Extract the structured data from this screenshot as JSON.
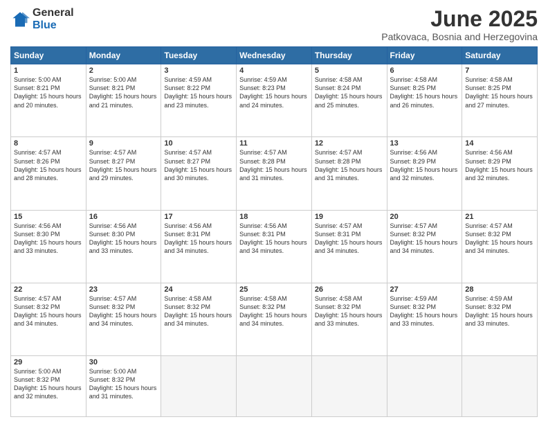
{
  "logo": {
    "general": "General",
    "blue": "Blue"
  },
  "title": "June 2025",
  "subtitle": "Patkovaca, Bosnia and Herzegovina",
  "headers": [
    "Sunday",
    "Monday",
    "Tuesday",
    "Wednesday",
    "Thursday",
    "Friday",
    "Saturday"
  ],
  "weeks": [
    [
      {
        "day": "1",
        "sunrise": "5:00 AM",
        "sunset": "8:21 PM",
        "daylight": "15 hours and 20 minutes."
      },
      {
        "day": "2",
        "sunrise": "5:00 AM",
        "sunset": "8:21 PM",
        "daylight": "15 hours and 21 minutes."
      },
      {
        "day": "3",
        "sunrise": "4:59 AM",
        "sunset": "8:22 PM",
        "daylight": "15 hours and 23 minutes."
      },
      {
        "day": "4",
        "sunrise": "4:59 AM",
        "sunset": "8:23 PM",
        "daylight": "15 hours and 24 minutes."
      },
      {
        "day": "5",
        "sunrise": "4:58 AM",
        "sunset": "8:24 PM",
        "daylight": "15 hours and 25 minutes."
      },
      {
        "day": "6",
        "sunrise": "4:58 AM",
        "sunset": "8:25 PM",
        "daylight": "15 hours and 26 minutes."
      },
      {
        "day": "7",
        "sunrise": "4:58 AM",
        "sunset": "8:25 PM",
        "daylight": "15 hours and 27 minutes."
      }
    ],
    [
      {
        "day": "8",
        "sunrise": "4:57 AM",
        "sunset": "8:26 PM",
        "daylight": "15 hours and 28 minutes."
      },
      {
        "day": "9",
        "sunrise": "4:57 AM",
        "sunset": "8:27 PM",
        "daylight": "15 hours and 29 minutes."
      },
      {
        "day": "10",
        "sunrise": "4:57 AM",
        "sunset": "8:27 PM",
        "daylight": "15 hours and 30 minutes."
      },
      {
        "day": "11",
        "sunrise": "4:57 AM",
        "sunset": "8:28 PM",
        "daylight": "15 hours and 31 minutes."
      },
      {
        "day": "12",
        "sunrise": "4:57 AM",
        "sunset": "8:28 PM",
        "daylight": "15 hours and 31 minutes."
      },
      {
        "day": "13",
        "sunrise": "4:56 AM",
        "sunset": "8:29 PM",
        "daylight": "15 hours and 32 minutes."
      },
      {
        "day": "14",
        "sunrise": "4:56 AM",
        "sunset": "8:29 PM",
        "daylight": "15 hours and 32 minutes."
      }
    ],
    [
      {
        "day": "15",
        "sunrise": "4:56 AM",
        "sunset": "8:30 PM",
        "daylight": "15 hours and 33 minutes."
      },
      {
        "day": "16",
        "sunrise": "4:56 AM",
        "sunset": "8:30 PM",
        "daylight": "15 hours and 33 minutes."
      },
      {
        "day": "17",
        "sunrise": "4:56 AM",
        "sunset": "8:31 PM",
        "daylight": "15 hours and 34 minutes."
      },
      {
        "day": "18",
        "sunrise": "4:56 AM",
        "sunset": "8:31 PM",
        "daylight": "15 hours and 34 minutes."
      },
      {
        "day": "19",
        "sunrise": "4:57 AM",
        "sunset": "8:31 PM",
        "daylight": "15 hours and 34 minutes."
      },
      {
        "day": "20",
        "sunrise": "4:57 AM",
        "sunset": "8:32 PM",
        "daylight": "15 hours and 34 minutes."
      },
      {
        "day": "21",
        "sunrise": "4:57 AM",
        "sunset": "8:32 PM",
        "daylight": "15 hours and 34 minutes."
      }
    ],
    [
      {
        "day": "22",
        "sunrise": "4:57 AM",
        "sunset": "8:32 PM",
        "daylight": "15 hours and 34 minutes."
      },
      {
        "day": "23",
        "sunrise": "4:57 AM",
        "sunset": "8:32 PM",
        "daylight": "15 hours and 34 minutes."
      },
      {
        "day": "24",
        "sunrise": "4:58 AM",
        "sunset": "8:32 PM",
        "daylight": "15 hours and 34 minutes."
      },
      {
        "day": "25",
        "sunrise": "4:58 AM",
        "sunset": "8:32 PM",
        "daylight": "15 hours and 34 minutes."
      },
      {
        "day": "26",
        "sunrise": "4:58 AM",
        "sunset": "8:32 PM",
        "daylight": "15 hours and 33 minutes."
      },
      {
        "day": "27",
        "sunrise": "4:59 AM",
        "sunset": "8:32 PM",
        "daylight": "15 hours and 33 minutes."
      },
      {
        "day": "28",
        "sunrise": "4:59 AM",
        "sunset": "8:32 PM",
        "daylight": "15 hours and 33 minutes."
      }
    ],
    [
      {
        "day": "29",
        "sunrise": "5:00 AM",
        "sunset": "8:32 PM",
        "daylight": "15 hours and 32 minutes."
      },
      {
        "day": "30",
        "sunrise": "5:00 AM",
        "sunset": "8:32 PM",
        "daylight": "15 hours and 31 minutes."
      },
      null,
      null,
      null,
      null,
      null
    ]
  ]
}
